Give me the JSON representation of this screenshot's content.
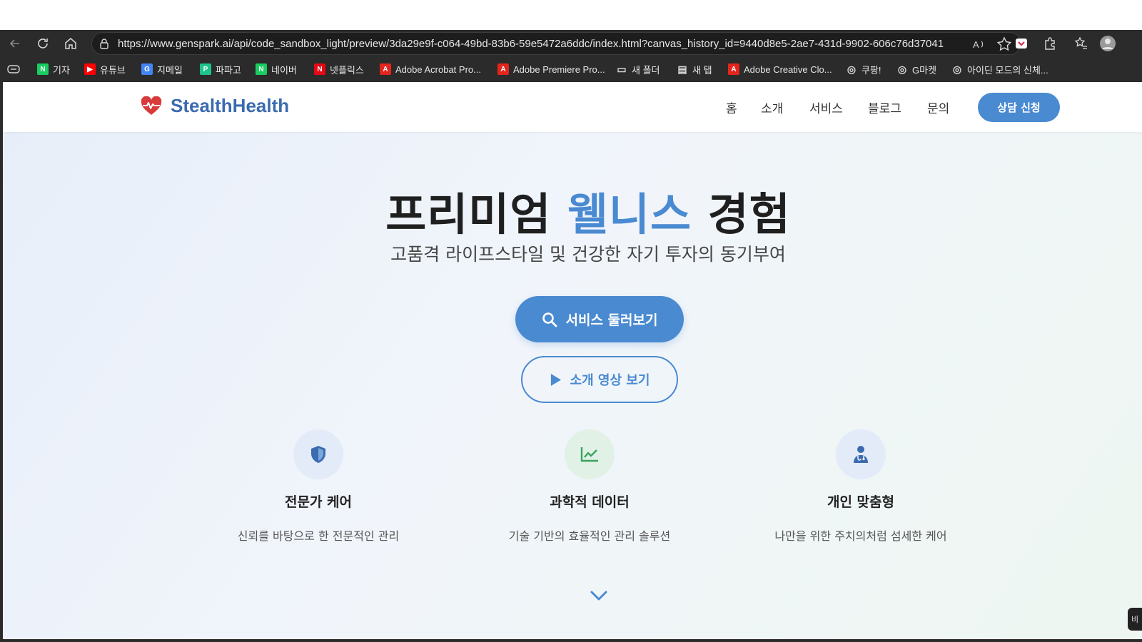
{
  "browser": {
    "url": "https://www.genspark.ai/api/code_sandbox_light/preview/3da29e9f-c064-49bd-83b6-59e5472a6ddc/index.html?canvas_history_id=9440d8e5-2ae7-431d-9902-606c76d37041",
    "bookmarks": [
      {
        "label": "기자",
        "icon": "naver-icon",
        "color": "#19ce60",
        "glyph": "N"
      },
      {
        "label": "유튜브",
        "icon": "youtube-icon",
        "color": "#ff0000",
        "glyph": "▶"
      },
      {
        "label": "지메일",
        "icon": "google-icon",
        "color": "#4285f4",
        "glyph": "G"
      },
      {
        "label": "파파고",
        "icon": "papago-icon",
        "color": "#1ec38b",
        "glyph": "P"
      },
      {
        "label": "네이버",
        "icon": "naver-icon",
        "color": "#19ce60",
        "glyph": "N"
      },
      {
        "label": "넷플릭스",
        "icon": "netflix-icon",
        "color": "#e50914",
        "glyph": "N"
      },
      {
        "label": "Adobe Acrobat Pro...",
        "icon": "adobe-icon",
        "color": "#e3251c",
        "glyph": "A"
      },
      {
        "label": "Adobe Premiere Pro...",
        "icon": "adobe-icon",
        "color": "#e3251c",
        "glyph": "A"
      },
      {
        "label": "새 폴더",
        "icon": "folder-icon",
        "color": "transparent",
        "glyph": "▭"
      },
      {
        "label": "새 탭",
        "icon": "newtab-icon",
        "color": "transparent",
        "glyph": "▤"
      },
      {
        "label": "Adobe Creative Clo...",
        "icon": "adobe-icon",
        "color": "#e3251c",
        "glyph": "A"
      },
      {
        "label": "쿠팡!",
        "icon": "globe-icon",
        "color": "transparent",
        "glyph": "◎"
      },
      {
        "label": "G마켓",
        "icon": "globe-icon",
        "color": "transparent",
        "glyph": "◎"
      },
      {
        "label": "아이딘 모드의 신체...",
        "icon": "globe-icon",
        "color": "transparent",
        "glyph": "◎"
      }
    ]
  },
  "site": {
    "brand": "StealthHealth",
    "nav": [
      "홈",
      "소개",
      "서비스",
      "블로그",
      "문의"
    ],
    "cta": "상담 신청",
    "hero": {
      "title_pre": "프리미엄 ",
      "title_accent": "웰니스",
      "title_post": " 경험",
      "subtitle": "고품격 라이프스타일 및 건강한 자기 투자의 동기부여",
      "primary_button": "서비스 둘러보기",
      "secondary_button": "소개 영상 보기"
    },
    "features": [
      {
        "title": "전문가 케어",
        "desc": "신뢰를 바탕으로 한 전문적인 관리",
        "icon": "shield-icon"
      },
      {
        "title": "과학적 데이터",
        "desc": "기술 기반의 효율적인 관리 솔루션",
        "icon": "chart-line-icon"
      },
      {
        "title": "개인 맞춤형",
        "desc": "나만을 위한 주치의처럼 섬세한 케어",
        "icon": "doctor-icon"
      }
    ],
    "edge_tab": "비"
  },
  "colors": {
    "accent": "#4a8ad1",
    "brand": "#3b6bb0",
    "heart": "#d93a3a",
    "green": "#3aa45c"
  }
}
